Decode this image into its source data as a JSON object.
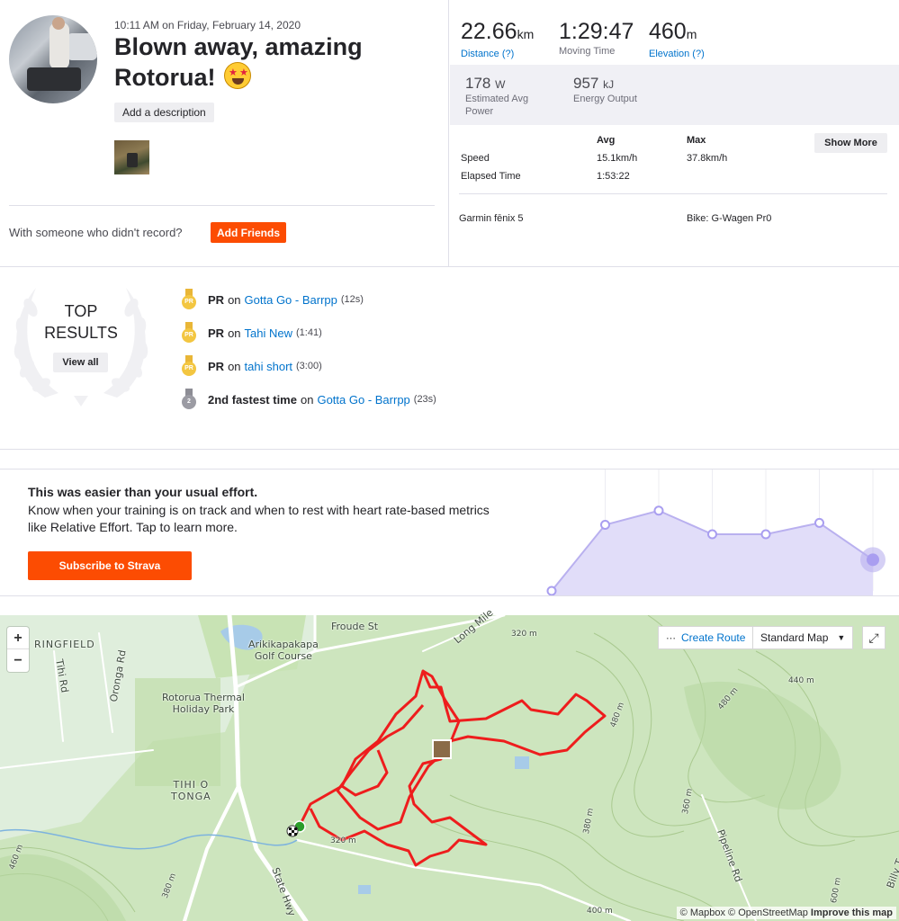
{
  "activity": {
    "datetime": "10:11 AM on Friday, February 14, 2020",
    "title": "Blown away, amazing Rotorua!",
    "emoji": "star-struck-emoji",
    "add_description": "Add a description",
    "with_someone": "With someone who didn't record?",
    "add_friends": "Add Friends"
  },
  "stats": {
    "distance": {
      "value": "22.66",
      "unit": "km",
      "label": "Distance (?)"
    },
    "moving_time": {
      "value": "1:29:47",
      "label": "Moving Time"
    },
    "elevation": {
      "value": "460",
      "unit": "m",
      "label": "Elevation (?)"
    },
    "power": {
      "value": "178",
      "unit": "W",
      "label_1": "Estimated Avg",
      "label_2": "Power"
    },
    "energy": {
      "value": "957",
      "unit": "kJ",
      "label": "Energy Output"
    },
    "table": {
      "col_avg": "Avg",
      "col_max": "Max",
      "rows": [
        {
          "label": "Speed",
          "avg": "15.1km/h",
          "max": "37.8km/h"
        },
        {
          "label": "Elapsed Time",
          "avg": "1:53:22",
          "max": ""
        }
      ]
    },
    "show_more": "Show More",
    "device": "Garmin fēnix 5",
    "bike": "Bike: G-Wagen Pr0"
  },
  "top_results": {
    "title_1": "TOP",
    "title_2": "RESULTS",
    "view_all": "View all",
    "items": [
      {
        "medal": "PR",
        "prefix": "PR",
        "on": "on",
        "segment": "Gotta Go - Barrpp",
        "time": "(12s)"
      },
      {
        "medal": "PR",
        "prefix": "PR",
        "on": "on",
        "segment": "Tahi New",
        "time": "(1:41)"
      },
      {
        "medal": "PR",
        "prefix": "PR",
        "on": "on",
        "segment": "tahi short",
        "time": "(3:00)"
      },
      {
        "medal": "2",
        "prefix": "2nd fastest time",
        "on": "on",
        "segment": "Gotta Go - Barrpp",
        "time": "(23s)"
      }
    ]
  },
  "effort": {
    "title": "This was easier than your usual effort.",
    "body": "Know when your training is on track and when to rest with heart rate-based metrics like Relative Effort. Tap to learn more.",
    "button": "Subscribe to Strava",
    "points": [
      0.0,
      0.7,
      0.85,
      0.6,
      0.6,
      0.72,
      0.33
    ],
    "colors": {
      "fill": "#e1ddf9",
      "line": "#b9b0ef",
      "dot": "#a99ef0"
    }
  },
  "map": {
    "create_route": "Create Route",
    "standard_map": "Standard Map",
    "zoom_in": "+",
    "zoom_out": "−",
    "labels": {
      "froude": "Froude St",
      "ringfield": "RINGFIELD",
      "golf": "Arikikapakapa\nGolf Course",
      "thermal": "Rotorua Thermal\nHoliday Park",
      "tihi": "TIHI O\nTONGA",
      "long": "Long Mile",
      "pipeline": "Pipeline Rd",
      "state": "State Hwy",
      "tihi_rd": "Tihi Rd",
      "oronga": "Oronga Rd",
      "billy": "Billy T",
      "c320a": "320 m",
      "c320b": "320 m",
      "c440": "440 m",
      "c480a": "480 m",
      "c480b": "480 m",
      "c460": "460 m",
      "c380a": "380 m",
      "c380b": "380 m",
      "c360": "360 m",
      "c600": "600 m",
      "c400": "400 m"
    },
    "attribution_1": "© Mapbox",
    "attribution_2": "© OpenStreetMap",
    "attribution_3": "Improve this map",
    "route_color": "#ee1d1d"
  }
}
